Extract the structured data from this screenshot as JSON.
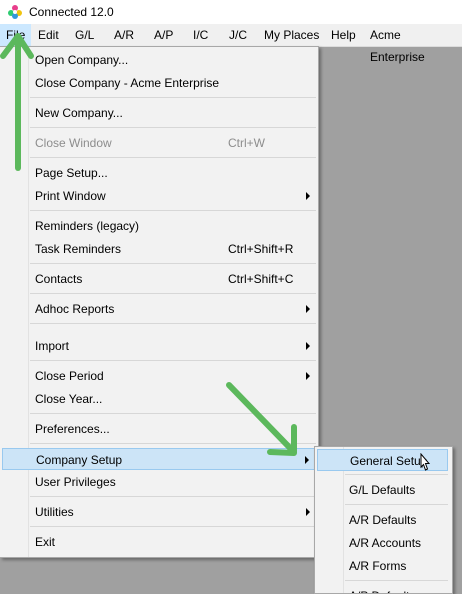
{
  "window": {
    "title": "Connected 12.0",
    "logo_icon": "connected-logo-icon"
  },
  "menubar": [
    {
      "label": "File",
      "active": true
    },
    {
      "label": "Edit"
    },
    {
      "label": "G/L"
    },
    {
      "label": "A/R"
    },
    {
      "label": "A/P"
    },
    {
      "label": "I/C"
    },
    {
      "label": "J/C"
    },
    {
      "label": "My Places"
    },
    {
      "label": "Help"
    },
    {
      "label": "Acme Enterprise"
    }
  ],
  "file_menu": {
    "open_company": "Open Company...",
    "close_company": "Close Company - Acme Enterprise",
    "new_company": "New Company...",
    "close_window": "Close Window",
    "close_window_shortcut": "Ctrl+W",
    "page_setup": "Page Setup...",
    "print_window": "Print Window",
    "reminders_legacy": "Reminders (legacy)",
    "task_reminders": "Task Reminders",
    "task_reminders_shortcut": "Ctrl+Shift+R",
    "contacts": "Contacts",
    "contacts_shortcut": "Ctrl+Shift+C",
    "adhoc_reports": "Adhoc Reports",
    "import": "Import",
    "close_period": "Close Period",
    "close_year": "Close Year...",
    "preferences": "Preferences...",
    "company_setup": "Company Setup",
    "user_privileges": "User Privileges",
    "utilities": "Utilities",
    "exit": "Exit"
  },
  "company_setup_submenu": {
    "general_setup": "General Setup",
    "gl_defaults": "G/L Defaults",
    "ar_defaults": "A/R Defaults",
    "ar_accounts": "A/R Accounts",
    "ar_forms": "A/R Forms",
    "ap_defaults": "A/P Defaults"
  },
  "colors": {
    "highlight": "#cce4f7",
    "annotation_arrow": "#5cb85c"
  }
}
